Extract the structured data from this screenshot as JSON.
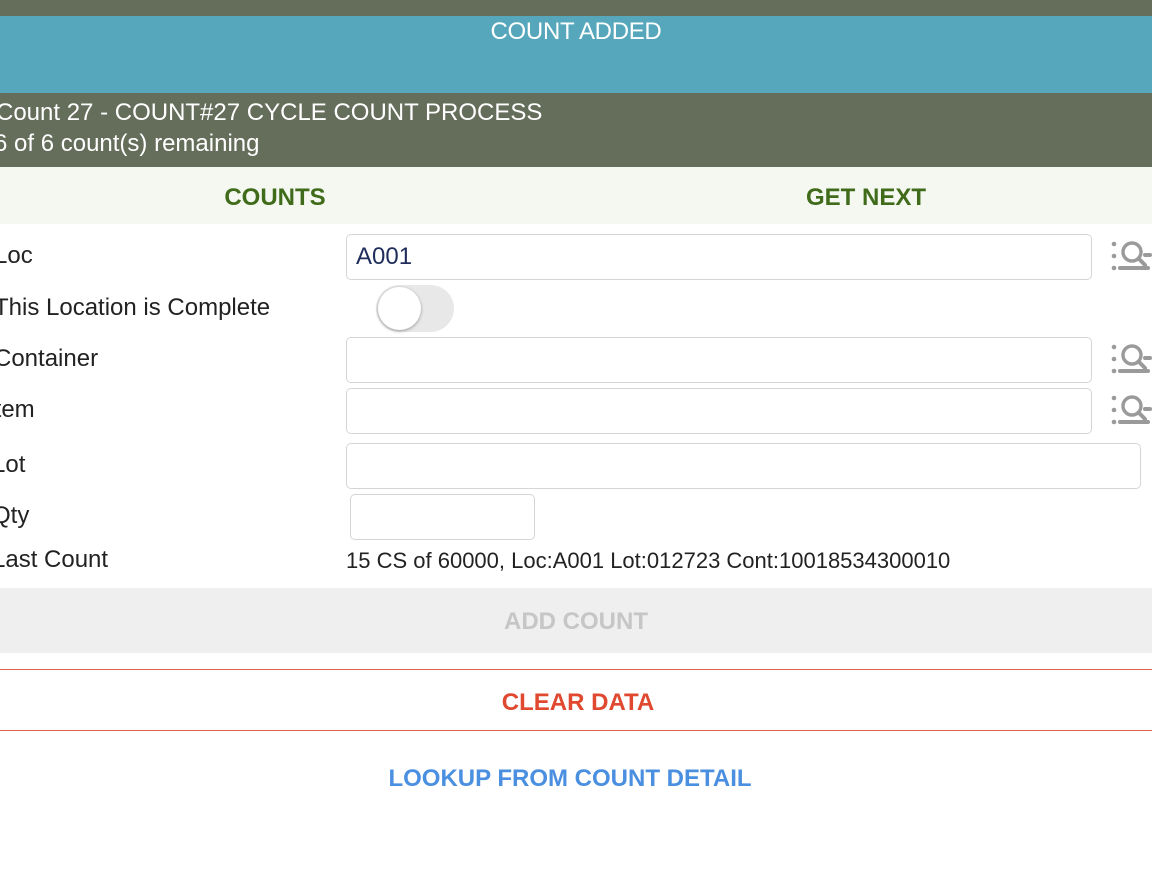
{
  "banner": {
    "message": "COUNT ADDED"
  },
  "header": {
    "title": "Count 27 - COUNT#27 CYCLE COUNT PROCESS",
    "subtitle": "6 of 6 count(s) remaining"
  },
  "tabs": [
    {
      "label": "COUNTS"
    },
    {
      "label": "GET NEXT"
    }
  ],
  "form": {
    "loc": {
      "label": "Loc",
      "value": "A001"
    },
    "location_complete": {
      "label": "This Location is Complete",
      "checked": false
    },
    "container": {
      "label": "Container",
      "value": ""
    },
    "item": {
      "label": "Item",
      "value": ""
    },
    "lot": {
      "label": "Lot",
      "value": ""
    },
    "qty": {
      "label": "Qty",
      "value": ""
    },
    "last_count": {
      "label": "Last Count",
      "value": "15 CS of 60000, Loc:A001 Lot:012723 Cont:10018534300010"
    }
  },
  "actions": {
    "add_count": "ADD COUNT",
    "clear_data": "CLEAR DATA",
    "lookup": "LOOKUP FROM COUNT DETAIL"
  },
  "icons": {
    "lookup": "list-search-icon"
  },
  "colors": {
    "header_bg": "#656d5b",
    "banner_bg": "#56a7bb",
    "tab_text": "#3f6b1a",
    "clear_red": "#e0482f",
    "lookup_blue": "#4a8fe0"
  }
}
